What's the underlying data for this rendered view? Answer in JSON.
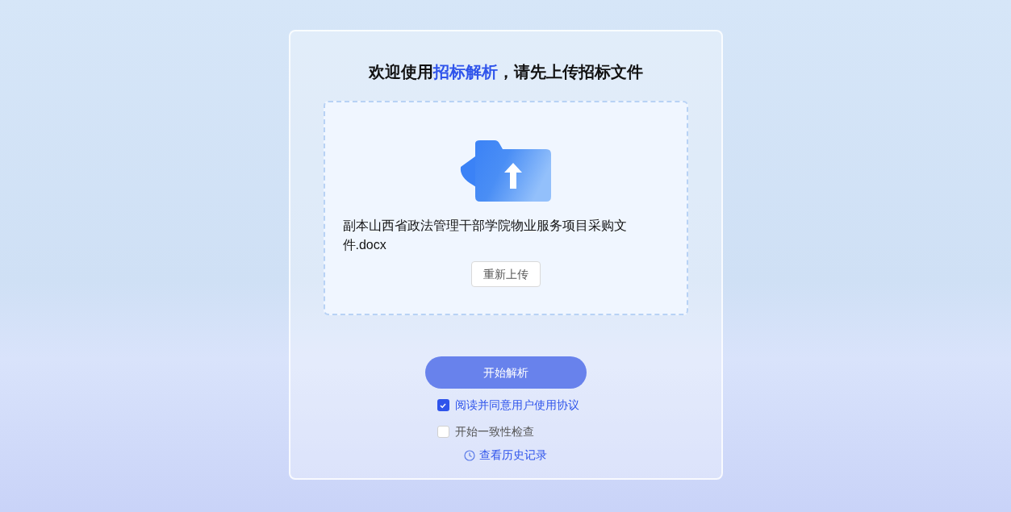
{
  "title": [
    {
      "text": "欢迎使用",
      "highlight": false
    },
    {
      "text": "招标解析",
      "highlight": true
    },
    {
      "text": "，请先上传招标文件",
      "highlight": false
    }
  ],
  "upload": {
    "file_name": "副本山西省政法管理干部学院物业服务项目采购文件.docx",
    "reupload_button": "重新上传"
  },
  "start_button": "开始解析",
  "options": [
    {
      "label": "阅读并同意用户使用协议",
      "checked": true
    },
    {
      "label": "开始一致性检查",
      "checked": false
    }
  ],
  "history_link": "查看历史记录"
}
